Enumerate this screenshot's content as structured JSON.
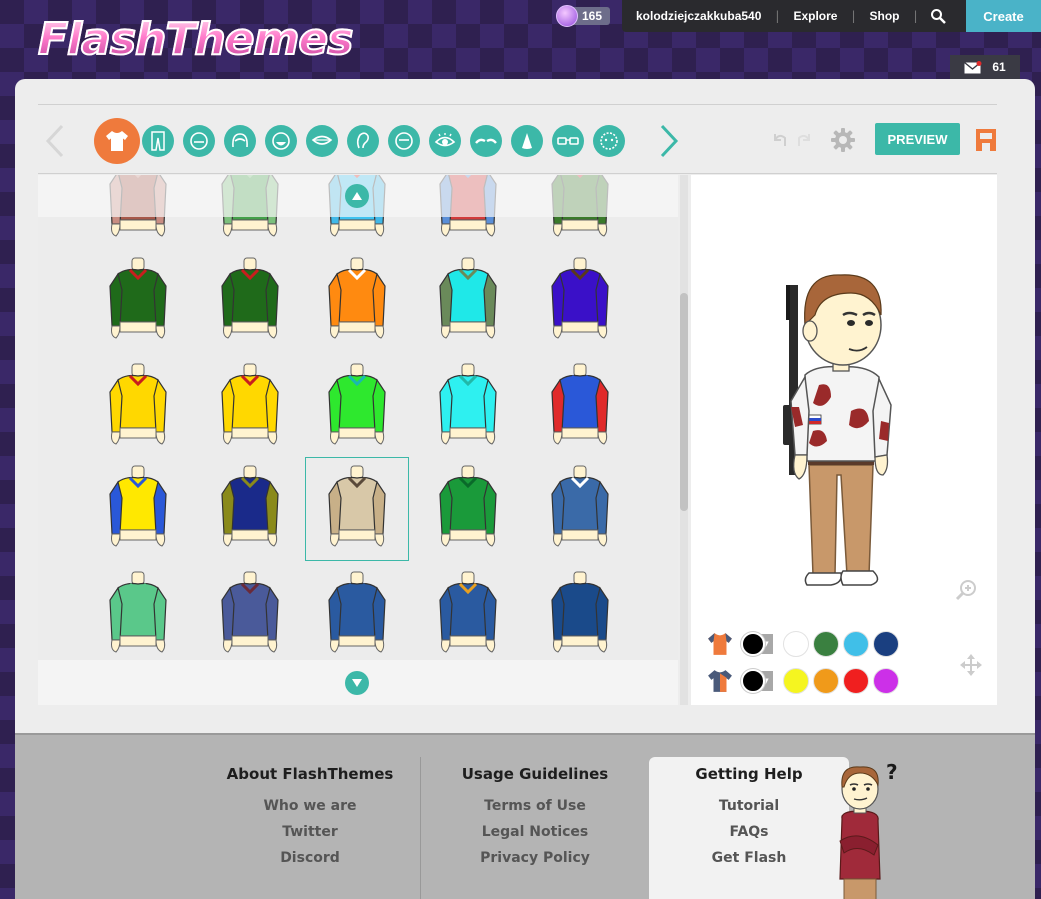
{
  "header": {
    "logo_text": "FlashThemes",
    "coins": "165",
    "username": "kolodziejczakkuba540",
    "nav": [
      "Explore",
      "Shop"
    ],
    "create_label": "Create",
    "mail_count": "61"
  },
  "toolbar": {
    "preview_label": "PREVIEW",
    "tabs": [
      "shirt-tab",
      "pants-tab",
      "face-shape-tab",
      "hair-tab",
      "beard-tab",
      "mouth-tab",
      "ear-tab",
      "eyebrow-tab",
      "eye-tab",
      "eyebrow-shape-tab",
      "nose-tab",
      "glasses-tab",
      "mask-tab"
    ]
  },
  "grid": {
    "items": [
      {
        "name": "shirt-brown-collar",
        "body": "#a7584a",
        "sleeve": "#c98d82",
        "accent": "#c98d82"
      },
      {
        "name": "shirt-green-polo",
        "body": "#44a04a",
        "sleeve": "#7cc07c",
        "accent": "#7cc07c"
      },
      {
        "name": "hoodie-cyan",
        "body": "#3ec3f0",
        "sleeve": "#40b8e8",
        "accent": "#e0302a"
      },
      {
        "name": "shirt-red-blue",
        "body": "#d23a3a",
        "sleeve": "#5a8fd8",
        "accent": "#5a8fd8"
      },
      {
        "name": "hoodie-green-red",
        "body": "#3a7a2a",
        "sleeve": "#3a7a2a",
        "accent": "#d0343a"
      },
      {
        "name": "sweater-green-red-collar",
        "body": "#1f6a1a",
        "sleeve": "#1f6a1a",
        "accent": "#c81e1e"
      },
      {
        "name": "sweater-green-red-collar-2",
        "body": "#1f6a1a",
        "sleeve": "#1f6a1a",
        "accent": "#c81e1e"
      },
      {
        "name": "shirt-orange-wings",
        "body": "#ff8a10",
        "sleeve": "#ff8a10",
        "accent": "#ffffff"
      },
      {
        "name": "jacket-green-cyan",
        "body": "#1fe8e8",
        "sleeve": "#6a8a5a",
        "accent": "#6a8a5a"
      },
      {
        "name": "shirt-purple-scarf",
        "body": "#3a10c8",
        "sleeve": "#3a10c8",
        "accent": "#5a3a1a"
      },
      {
        "name": "polo-yellow-red",
        "body": "#ffd800",
        "sleeve": "#ffd800",
        "accent": "#c81e1e"
      },
      {
        "name": "polo-yellow-red-2",
        "body": "#ffd800",
        "sleeve": "#ffd800",
        "accent": "#c81e1e"
      },
      {
        "name": "tee-green-star",
        "body": "#2ee82e",
        "sleeve": "#2ee82e",
        "accent": "#1ab8b0"
      },
      {
        "name": "tee-cyan",
        "body": "#2ef0f0",
        "sleeve": "#2ef0f0",
        "accent": "#22b8a8"
      },
      {
        "name": "overalls-red-blue",
        "body": "#2a58d8",
        "sleeve": "#e02a2a",
        "accent": "#2a58d8"
      },
      {
        "name": "jacket-blue-yellow",
        "body": "#ffe800",
        "sleeve": "#2a58d8",
        "accent": "#2a58d8"
      },
      {
        "name": "vest-olive-navy",
        "body": "#1a2a8a",
        "sleeve": "#8a8a1a",
        "accent": "#8a8a1a"
      },
      {
        "name": "camo-with-rifle",
        "body": "#d8c8a8",
        "sleeve": "#c8b088",
        "accent": "#5a4a3a"
      },
      {
        "name": "jacket-green-military",
        "body": "#1a9a3a",
        "sleeve": "#1a9a3a",
        "accent": "#0a6a2a"
      },
      {
        "name": "shirt-blue-white-stripe",
        "body": "#3a6aa8",
        "sleeve": "#3a6aa8",
        "accent": "#ffffff"
      },
      {
        "name": "tee-mint",
        "body": "#5ac88a",
        "sleeve": "#5ac88a",
        "accent": "#5ac88a"
      },
      {
        "name": "suit-slate",
        "body": "#4a5a9a",
        "sleeve": "#4a5a9a",
        "accent": "#6a2a3a"
      },
      {
        "name": "hoodie-blue",
        "body": "#2a5aa0",
        "sleeve": "#2a5aa0",
        "accent": "#2a5aa0"
      },
      {
        "name": "uniform-blue-police",
        "body": "#2a5aa0",
        "sleeve": "#2a5aa0",
        "accent": "#e8a020"
      },
      {
        "name": "puffer-navy",
        "body": "#1a4a8a",
        "sleeve": "#1a4a8a",
        "accent": "#1a4a8a"
      }
    ]
  },
  "colors": {
    "row1": [
      "#000000",
      "#ffffff",
      "#3a8040",
      "#40bfe8",
      "#1a3f80"
    ],
    "row2": [
      "#000000",
      "#f5f520",
      "#f09a1a",
      "#f01f1f",
      "#cc30e8"
    ]
  },
  "footer": {
    "col1": {
      "title": "About FlashThemes",
      "links": [
        "Who we are",
        "Twitter",
        "Discord"
      ]
    },
    "col2": {
      "title": "Usage Guidelines",
      "links": [
        "Terms of Use",
        "Legal Notices",
        "Privacy Policy"
      ]
    },
    "col3": {
      "title": "Getting Help",
      "links": [
        "Tutorial",
        "FAQs",
        "Get Flash"
      ]
    }
  }
}
